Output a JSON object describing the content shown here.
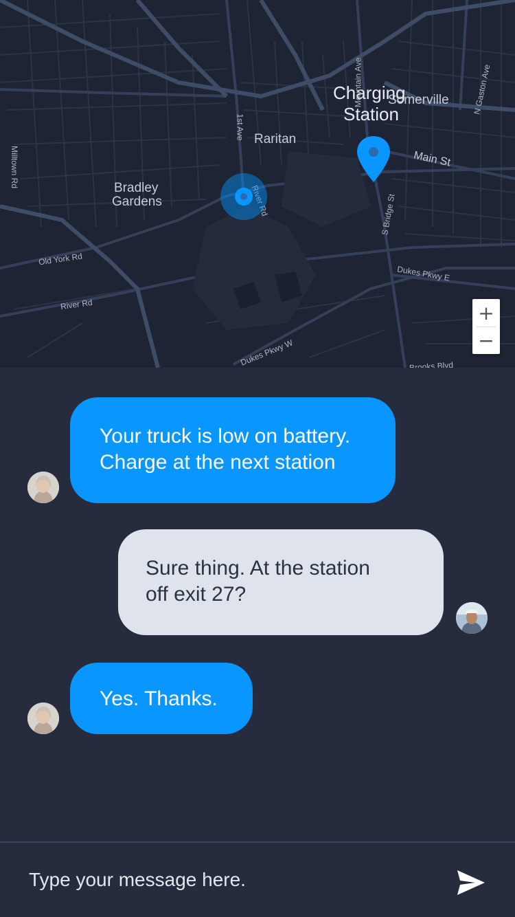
{
  "map": {
    "labels": {
      "charging_station_line1": "Charging",
      "charging_station_line2": "Station",
      "somerville": "Somerville",
      "raritan": "Raritan",
      "bradley_gardens_line1": "Bradley",
      "bradley_gardens_line2": "Gardens",
      "main_st": "Main St",
      "first_ave": "1st Ave",
      "river_rd_vertical": "River Rd",
      "mountain_ave": "Mountain Ave",
      "n_gaston_ave": "N Gaston Ave",
      "s_bridge_st": "S Bridge St",
      "milltown_rd": "Milltown Rd",
      "old_york_rd": "Old York Rd",
      "river_rd": "River Rd",
      "dukes_pkwy_e": "Dukes Pkwy E",
      "dukes_pkwy_w": "Dukes Pkwy W",
      "brooks_blvd": "Brooks Blvd"
    },
    "zoom": {
      "in_label": "+",
      "out_label": "−"
    },
    "colors": {
      "background": "#1e2433",
      "road": "#34405a",
      "major_road": "#3f4c68",
      "pin": "#0a96ff"
    }
  },
  "chat": {
    "messages": [
      {
        "sender": "dispatcher",
        "lines": [
          "Your truck is low on battery.",
          "Charge at the next station"
        ]
      },
      {
        "sender": "driver",
        "lines": [
          "Sure thing. At the station",
          "off exit 27?"
        ]
      },
      {
        "sender": "dispatcher",
        "lines": [
          "Yes. Thanks."
        ]
      }
    ],
    "colors": {
      "incoming_bubble": "#0a96ff",
      "outgoing_bubble": "#dfe4ec",
      "background": "#262c3d"
    }
  },
  "composer": {
    "placeholder": "Type your message here.",
    "send_icon": "send-icon"
  }
}
